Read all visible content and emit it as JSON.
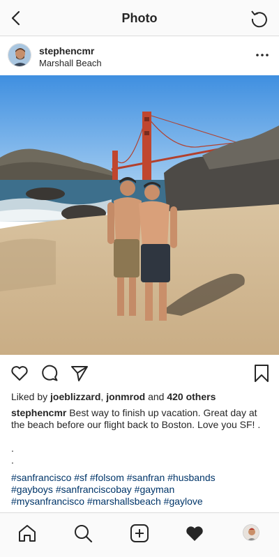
{
  "header": {
    "title": "Photo",
    "back_icon": "chevron-left-icon",
    "refresh_icon": "refresh-icon"
  },
  "post": {
    "username": "stephencmr",
    "location": "Marshall Beach",
    "more_icon": "ellipsis-icon"
  },
  "likes": {
    "prefix": "Liked by",
    "user1": "joeblizzard",
    "sep": ",",
    "user2": "jonmrod",
    "and": "and",
    "others": "420 others"
  },
  "caption": {
    "username": "stephencmr",
    "text": "Best way to finish up vacation. Great day at the beach before our flight back to Boston. Love you SF! .",
    "dots": [
      ".",
      "."
    ],
    "hashtags_line1": "#sanfrancisco #sf #folsom #sanfran #husbands",
    "hashtags_line2": "#gayboys #sanfranciscobay #gayman",
    "hashtags_line3": "#mysanfrancisco #marshallsbeach #gaylove"
  },
  "colors": {
    "text": "#262626",
    "hashtag": "#003569",
    "border": "#dbdbdb",
    "bar_bg": "#fafafa"
  },
  "bottom_nav": [
    "home-icon",
    "search-icon",
    "new-post-icon",
    "activity-heart-icon",
    "profile-avatar"
  ]
}
